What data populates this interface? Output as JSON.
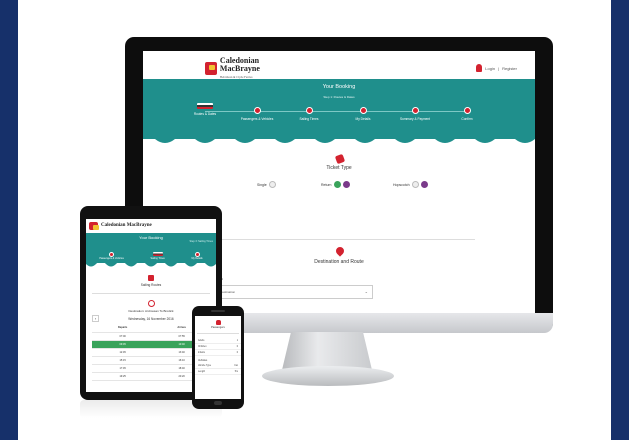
{
  "brand": {
    "name": "Caledonian MacBrayne",
    "sub": "Hebridean & Clyde Ferries",
    "color": "#d3222f"
  },
  "theme": {
    "teal": "#1f8f8c",
    "selected": "#3aa35b",
    "background": "#16306a"
  },
  "desktop": {
    "login": "Login",
    "register": "Register",
    "booking_title": "Your Booking",
    "step_text": "Step 1: Routes & Dates",
    "steps": [
      "Routes & Dates",
      "Passengers & Vehicles",
      "Sailing Times",
      "My Details",
      "Summary & Payment",
      "Confirm"
    ],
    "ticket_type": {
      "title": "Ticket Type",
      "options": [
        {
          "label": "Single",
          "checked": false
        },
        {
          "label": "Return",
          "checked": true
        },
        {
          "label": "Hopscotch",
          "checked": false
        }
      ]
    },
    "destination": {
      "title": "Destination and Route",
      "field_label": "Destination",
      "placeholder": "Select Destination"
    }
  },
  "tablet": {
    "brand": "Caledonian MacBrayne",
    "booking_title": "Your Booking",
    "breadcrumb": "Step 3: Sailing Times",
    "steps": [
      "Passengers & Vehicles",
      "Sailing Times",
      "My Details"
    ],
    "section": "Sailing Routes",
    "route": "Destination: Ardrossan To Brodick",
    "date": "Wednesday, 16 November 2016",
    "columns": [
      "Departs",
      "Arrives"
    ],
    "rows": [
      {
        "departs": "07:00",
        "arrives": "07:55",
        "selected": false
      },
      {
        "departs": "09:45",
        "arrives": "10:40",
        "selected": true
      },
      {
        "departs": "12:45",
        "arrives": "13:40",
        "selected": false
      },
      {
        "departs": "15:15",
        "arrives": "16:10",
        "selected": false
      },
      {
        "departs": "17:45",
        "arrives": "18:40",
        "selected": false
      },
      {
        "departs": "19:25",
        "arrives": "20:20",
        "selected": false
      }
    ]
  },
  "phone": {
    "title": "Passengers",
    "rows": [
      {
        "label": "Adults",
        "value": "1"
      },
      {
        "label": "Children",
        "value": "0"
      },
      {
        "label": "Infants",
        "value": "0"
      }
    ],
    "section": "Vehicles",
    "vehicle": "Car",
    "rows2": [
      {
        "label": "Vehicle Type",
        "value": "Car"
      },
      {
        "label": "Length",
        "value": "5m"
      }
    ]
  }
}
